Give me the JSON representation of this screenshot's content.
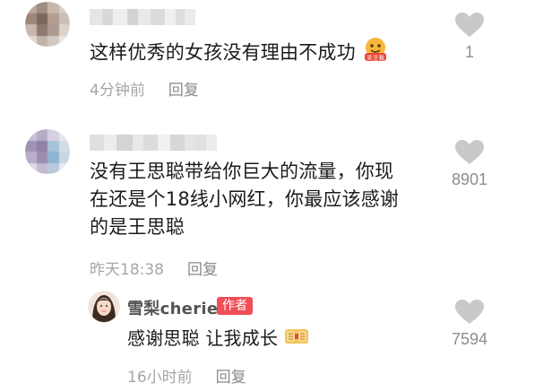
{
  "comments": [
    {
      "text": "这样优秀的女孩没有理由不成功",
      "emoji": "follow-me-emoji",
      "emoji_text": "关注我",
      "time": "4分钟前",
      "reply_label": "回复",
      "likes": "1"
    },
    {
      "text_lines": [
        "没有王思聪带给你巨大的流量，你现",
        "在还是个18线小网红，你最应该感谢",
        "的是王思聪"
      ],
      "time": "昨天18:38",
      "reply_label": "回复",
      "likes": "8901"
    }
  ],
  "reply": {
    "username": "雪梨cherie",
    "badge": "作者",
    "text": "感谢思聪 让我成长",
    "emoji": "fist-salute-emoji",
    "time": "16小时前",
    "reply_label": "回复",
    "likes": "7594"
  },
  "colors": {
    "badge": "#f04e56",
    "heart": "#c9c9c9",
    "meta": "#a6a6a6"
  },
  "icons": [
    "heart-icon"
  ]
}
